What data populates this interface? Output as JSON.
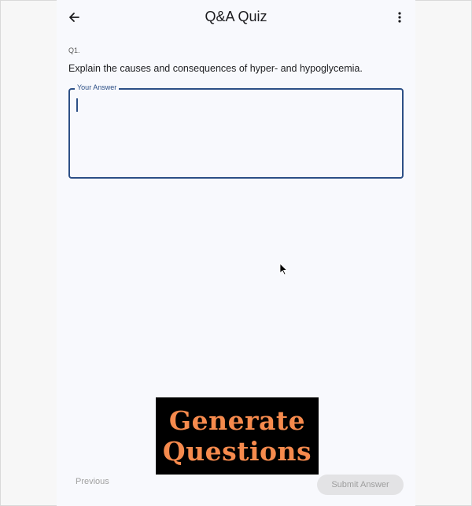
{
  "header": {
    "title": "Q&A Quiz",
    "back_icon": "arrow-left-icon",
    "menu_icon": "more-vert-icon"
  },
  "question": {
    "number": "Q1.",
    "text": "Explain the causes and consequences of hyper- and hypoglycemia."
  },
  "answer_field": {
    "label": "Your Answer",
    "value": "",
    "accent_color": "#2c4f86"
  },
  "banner": {
    "line1": "Generate",
    "line2": "Questions",
    "text_color": "#f68a4d",
    "background": "#000000"
  },
  "footer": {
    "previous_label": "Previous",
    "submit_label": "Submit Answer"
  }
}
